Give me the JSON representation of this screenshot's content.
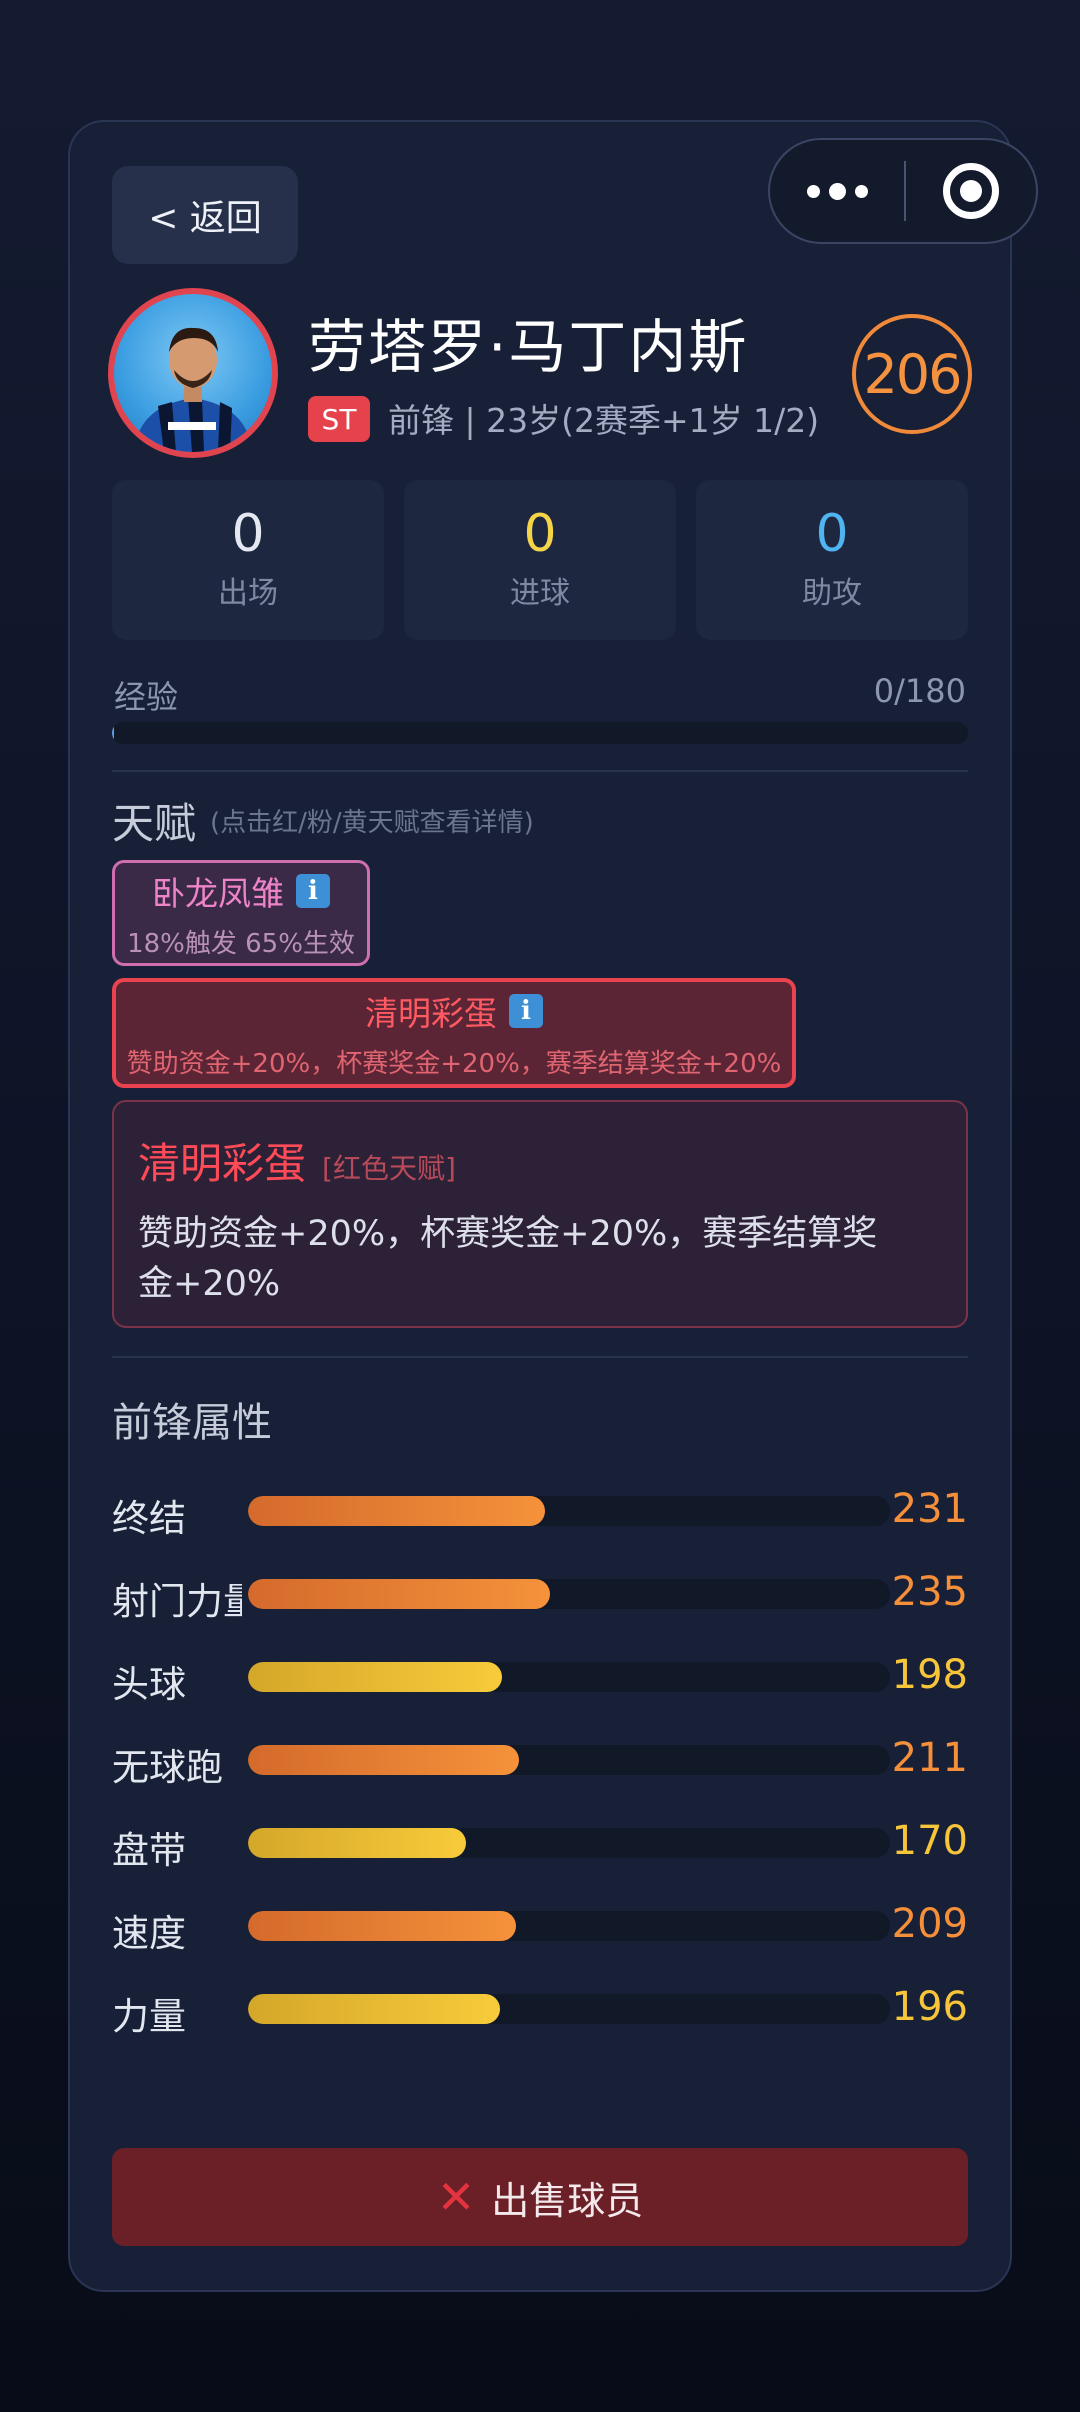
{
  "nav": {
    "back_label": "< 返回"
  },
  "player": {
    "name": "劳塔罗·马丁内斯",
    "position_badge": "ST",
    "meta": "前锋 | 23岁(2赛季+1岁 1/2)",
    "rating": "206"
  },
  "stats": [
    {
      "value": "0",
      "label": "出场",
      "color": "#e4e8f1"
    },
    {
      "value": "0",
      "label": "进球",
      "color": "#f5d547"
    },
    {
      "value": "0",
      "label": "助攻",
      "color": "#4fb4f0"
    }
  ],
  "experience": {
    "label": "经验",
    "value": "0/180",
    "progress": 0
  },
  "talents": {
    "title": "天赋",
    "hint": "(点击红/粉/黄天赋查看详情)",
    "items": [
      {
        "name": "卧龙凤雏",
        "desc": "18%触发 65%生效",
        "tier": "pink",
        "info_icon": "i"
      },
      {
        "name": "清明彩蛋",
        "desc": "赞助资金+20%，杯赛奖金+20%，赛季结算奖金+20%",
        "tier": "red",
        "info_icon": "i"
      }
    ],
    "detail": {
      "name": "清明彩蛋",
      "tag": "[红色天赋]",
      "desc": "赞助资金+20%，杯赛奖金+20%，赛季结算奖金+20%"
    }
  },
  "attributes": {
    "title": "前锋属性",
    "max": 500,
    "items": [
      {
        "name": "终结",
        "value": 231,
        "tier": "orange"
      },
      {
        "name": "射门力量",
        "value": 235,
        "tier": "orange"
      },
      {
        "name": "头球",
        "value": 198,
        "tier": "yellow"
      },
      {
        "name": "无球跑",
        "value": 211,
        "tier": "orange"
      },
      {
        "name": "盘带",
        "value": 170,
        "tier": "yellow"
      },
      {
        "name": "速度",
        "value": 209,
        "tier": "orange"
      },
      {
        "name": "力量",
        "value": 196,
        "tier": "yellow"
      }
    ]
  },
  "actions": {
    "sell_label": "出售球员",
    "sell_icon": "close-icon"
  },
  "colors": {
    "accent_orange": "#f58f3a",
    "accent_red": "#e5424c",
    "card_bg": "#172036"
  }
}
